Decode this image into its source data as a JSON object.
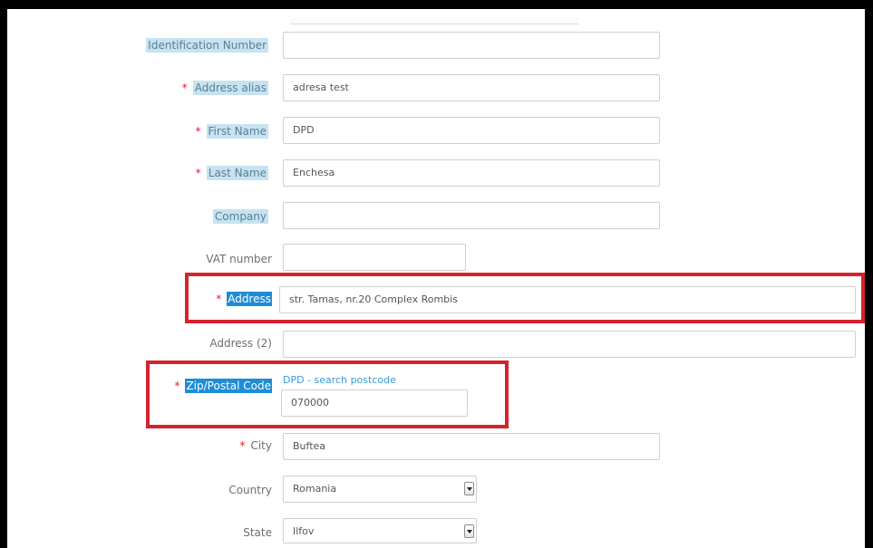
{
  "form": {
    "identification_number": {
      "label": "Identification Number",
      "value": ""
    },
    "address_alias": {
      "required_mark": "*",
      "label": "Address alias",
      "value": "adresa test"
    },
    "first_name": {
      "required_mark": "*",
      "label": "First Name",
      "value": "DPD"
    },
    "last_name": {
      "required_mark": "*",
      "label": "Last Name",
      "value": "Enchesa"
    },
    "company": {
      "label": "Company",
      "value": ""
    },
    "vat_number": {
      "label": "VAT number",
      "value": ""
    },
    "address": {
      "required_mark": "*",
      "label": "Address",
      "value": "str. Tamas, nr.20 Complex Rombis"
    },
    "address2": {
      "label": "Address (2)",
      "value": ""
    },
    "zip": {
      "required_mark": "*",
      "label": "Zip/Postal Code",
      "value": "070000",
      "search_link": "DPD - search postcode"
    },
    "city": {
      "required_mark": "*",
      "label": "City",
      "value": "Buftea"
    },
    "country": {
      "label": "Country",
      "value": "Romania"
    },
    "state": {
      "label": "State",
      "value": "Ilfov"
    }
  },
  "colors": {
    "highlight_box": "#d4232d",
    "required_mark": "#e0192f",
    "selection": "#1f8dd6",
    "link": "#3a9ad8"
  }
}
